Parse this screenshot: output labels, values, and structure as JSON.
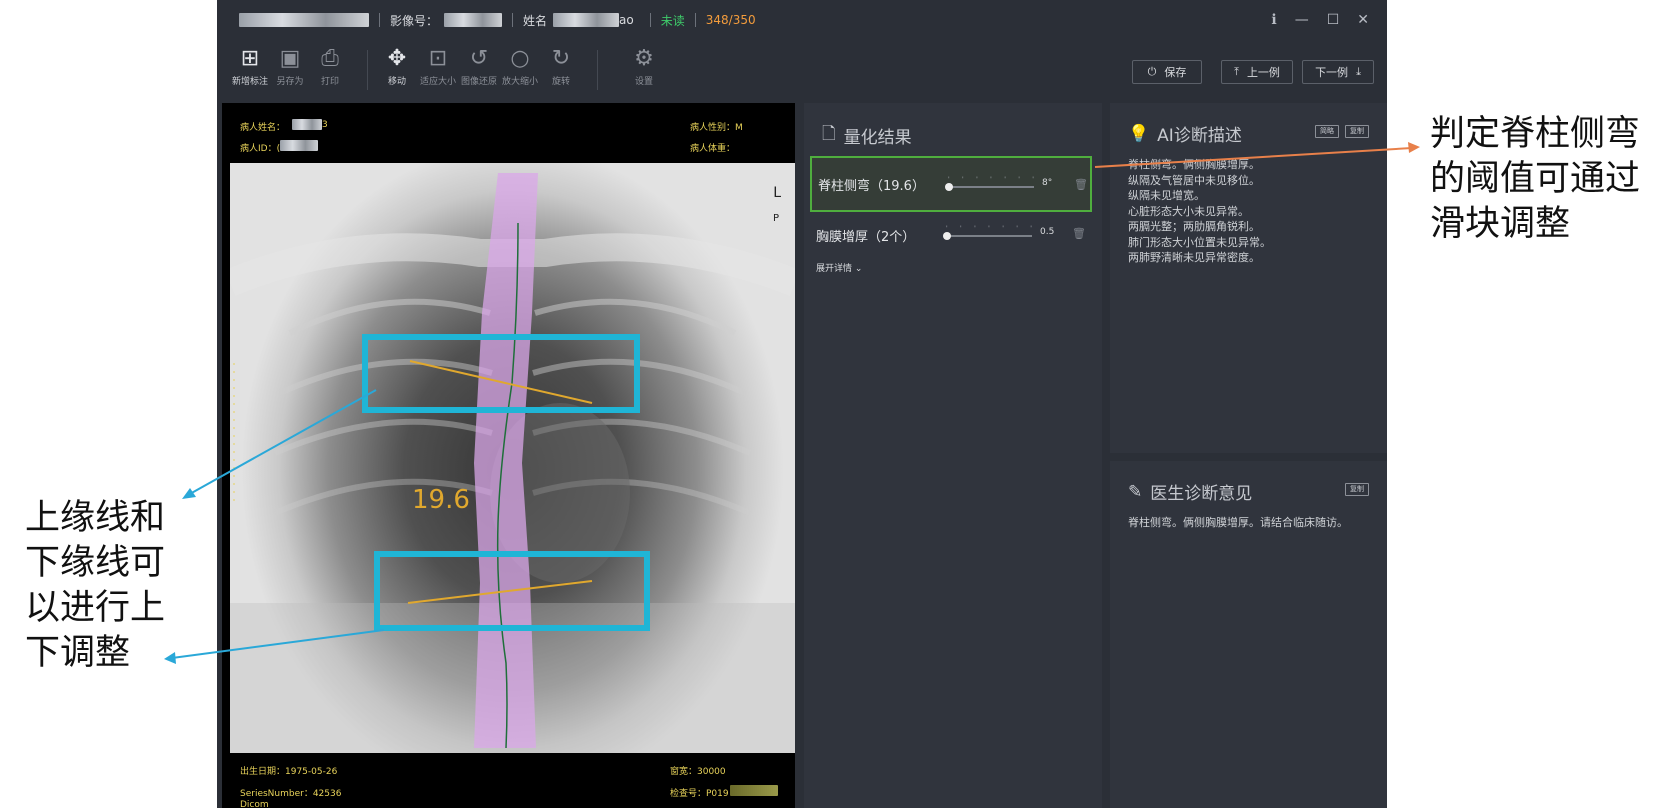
{
  "titlebar": {
    "image_no_label": "影像号：",
    "name_label": "姓名",
    "name_tail": "ao",
    "read_status": "未读",
    "progress": "348/350"
  },
  "toolbar": {
    "add_annotation": "新增标注",
    "save_as": "另存为",
    "print": "打印",
    "move": "移动",
    "fit_size": "适应大小",
    "restore_image": "图像还原",
    "zoom": "放大缩小",
    "rotate": "旋转",
    "settings": "设置",
    "save_button": "保存",
    "prev_button": "上一例",
    "next_button": "下一例"
  },
  "viewer": {
    "patient_name_label": "病人姓名：",
    "patient_name_tail": "3",
    "patient_id_label": "病人ID：(",
    "patient_sex": "病人性别：M",
    "patient_weight": "病人体重：",
    "birth_date": "出生日期：1975-05-26",
    "series_number": "SeriesNumber：42536",
    "modality": "Dicom",
    "window_width": "窗宽：30000",
    "exam_no": "检查号：P019",
    "angle_label": "19.6",
    "side_marker_1": "L",
    "side_marker_2": "P"
  },
  "quant": {
    "title": "量化结果",
    "items": [
      {
        "label": "脊柱侧弯（19.6）",
        "slider_value": "8°",
        "fraction": 0.0
      },
      {
        "label": "胸膜增厚（2个）",
        "slider_value": "0.5",
        "fraction": 0.0
      }
    ],
    "expand": "展开详情"
  },
  "ai_panel": {
    "title": "AI诊断描述",
    "btn_simplify": "简略",
    "btn_copy": "复制",
    "text": "脊柱侧弯。俩侧胸膜增厚。\n纵隔及气管居中未见移位。\n纵隔未见增宽。\n心脏形态大小未见异常。\n两膈光整；两肋膈角锐利。\n肺门形态大小位置未见异常。\n两肺野清晰未见异常密度。"
  },
  "doctor_panel": {
    "title": "医生诊断意见",
    "btn_copy": "复制",
    "text": "脊柱侧弯。俩侧胸膜增厚。请结合临床随访。"
  },
  "annotations": {
    "right": "判定脊柱侧弯\n的阈值可通过\n滑块调整",
    "left": "上缘线和\n下缘线可\n以进行上\n下调整"
  },
  "colors": {
    "app_bg": "#2b2f37",
    "panel_bg": "#30343d",
    "highlight_box": "#1fb5d6",
    "spine_overlay": "#d9a7e8",
    "angle_line": "#e0a82e",
    "selected_border": "#4fae3e",
    "annotation_arrow_orange": "#e8804a",
    "annotation_arrow_blue": "#2aa8d8"
  }
}
